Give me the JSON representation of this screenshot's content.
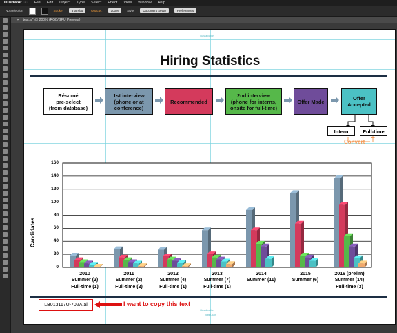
{
  "app": {
    "menu": [
      "Illustrator CC",
      "File",
      "Edit",
      "Object",
      "Type",
      "Select",
      "Effect",
      "View",
      "Window",
      "Help"
    ],
    "control_bar": {
      "selection": "No Selection",
      "stroke_label": "Stroke:",
      "stroke_value": "5 pt Flat",
      "opacity_label": "Opacity:",
      "opacity_value": "100%",
      "style_label": "Style:",
      "document_setup": "Document Setup",
      "preferences": "Preferences"
    },
    "document_tab": "test.ai* @ 200% (RGB/GPU Preview)"
  },
  "artboard": {
    "classification_top": "Classification",
    "classification_bottom": "Classification",
    "footer_small": "Jobs/Loan",
    "title": "Hiring Statistics",
    "steps": [
      {
        "label": "Résumé\npre-select\n(from database)",
        "fill": "#ffffff",
        "text_color": "#111111"
      },
      {
        "label": "1st interview\n(phone or at\nconference)",
        "fill": "#7b97ad",
        "text_color": "#111111"
      },
      {
        "label": "Recommended",
        "fill": "#d43a5c",
        "text_color": "#111111"
      },
      {
        "label": "2nd interview\n(phone for interns,\nonsite for full-time)",
        "fill": "#56b84a",
        "text_color": "#111111"
      },
      {
        "label": "Offer Made",
        "fill": "#6f4c9a",
        "text_color": "#111111"
      },
      {
        "label": "Offer\nAccepted",
        "fill": "#4bc1c4",
        "text_color": "#111111"
      }
    ],
    "sub_boxes": {
      "intern": "Intern",
      "full_time": "Full-time"
    },
    "convert_label": "Convert",
    "file_label": "LB013117U-702A.ai",
    "annotation": "I want to copy this text"
  },
  "chart_data": {
    "type": "bar",
    "ylabel": "Candidates",
    "ylim": [
      0,
      160
    ],
    "yticks": [
      0,
      20,
      40,
      60,
      80,
      100,
      120,
      140,
      160
    ],
    "categories": [
      "2010\nSummer (2)\nFull-time (1)",
      "2011\nSummer (2)\nFull-time (2)",
      "2012\nSummer (4)\nFull-time (1)",
      "2013\nSummer (7)\nFull-time (1)",
      "2014\nSummer (11)",
      "2015\nSummer (6)",
      "2016 (prelim)\nSummer (14)\nFull-time (3)"
    ],
    "series": [
      {
        "values": [
          18,
          28,
          27,
          57,
          88,
          114,
          137
        ],
        "color": "#7b97ad"
      },
      {
        "values": [
          11,
          15,
          17,
          20,
          57,
          67,
          96
        ],
        "color": "#d43a5c"
      },
      {
        "values": [
          8,
          11,
          12,
          15,
          36,
          18,
          48
        ],
        "color": "#56b84a"
      },
      {
        "values": [
          6,
          8,
          10,
          12,
          32,
          15,
          32
        ],
        "color": "#6f4c9a"
      },
      {
        "values": [
          4,
          6,
          7,
          9,
          13,
          10,
          14
        ],
        "color": "#4bc1c4"
      },
      {
        "values": [
          1,
          2,
          2,
          5,
          0,
          0,
          6
        ],
        "color": "#f0a86c"
      }
    ],
    "grid": true,
    "style": "3d-bars"
  }
}
